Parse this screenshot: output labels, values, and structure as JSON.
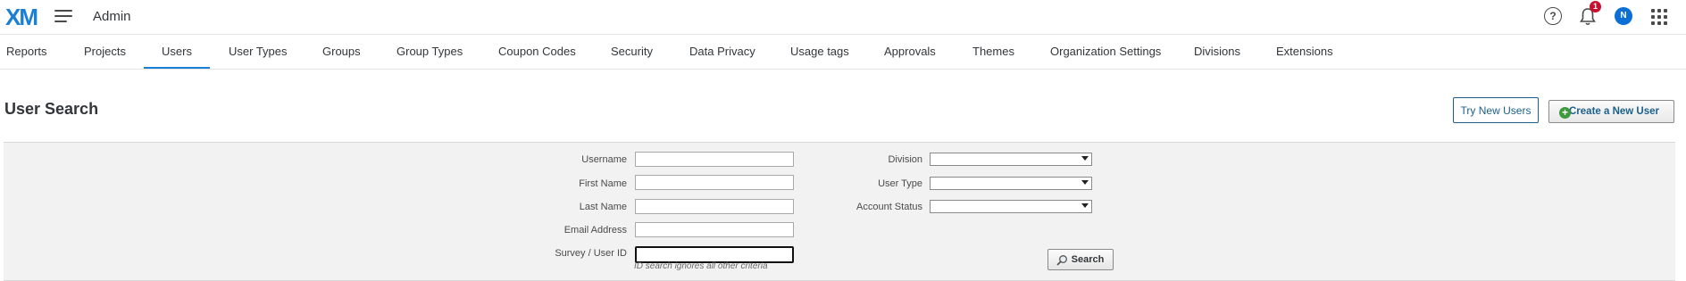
{
  "app": {
    "logo": "XM",
    "title": "Admin"
  },
  "header_icons": {
    "help_glyph": "?",
    "notifications_count": "1",
    "avatar_initial": "N"
  },
  "nav": {
    "tabs": [
      {
        "label": "Reports"
      },
      {
        "label": "Projects"
      },
      {
        "label": "Users",
        "active": true
      },
      {
        "label": "User Types"
      },
      {
        "label": "Groups"
      },
      {
        "label": "Group Types"
      },
      {
        "label": "Coupon Codes"
      },
      {
        "label": "Security"
      },
      {
        "label": "Data Privacy"
      },
      {
        "label": "Usage tags"
      },
      {
        "label": "Approvals"
      },
      {
        "label": "Themes"
      },
      {
        "label": "Organization Settings"
      },
      {
        "label": "Divisions"
      },
      {
        "label": "Extensions"
      }
    ]
  },
  "page": {
    "title": "User Search",
    "try_new_users_label": "Try New Users",
    "create_user_label": "Create a New User"
  },
  "search_form": {
    "username_label": "Username",
    "username_value": "",
    "first_name_label": "First Name",
    "first_name_value": "",
    "last_name_label": "Last Name",
    "last_name_value": "",
    "email_label": "Email Address",
    "email_value": "",
    "survey_id_label": "Survey / User ID",
    "survey_id_value": "",
    "survey_id_hint": "ID search ignores all other criteria",
    "division_label": "Division",
    "division_value": "",
    "user_type_label": "User Type",
    "user_type_value": "",
    "account_status_label": "Account Status",
    "account_status_value": "",
    "search_button_label": "Search"
  },
  "colors": {
    "accent": "#1a7fd6",
    "badge": "#c8102e",
    "panel_bg": "#f2f2f2",
    "create_plus": "#3d9a3d",
    "link_blue": "#1b5f8c"
  }
}
